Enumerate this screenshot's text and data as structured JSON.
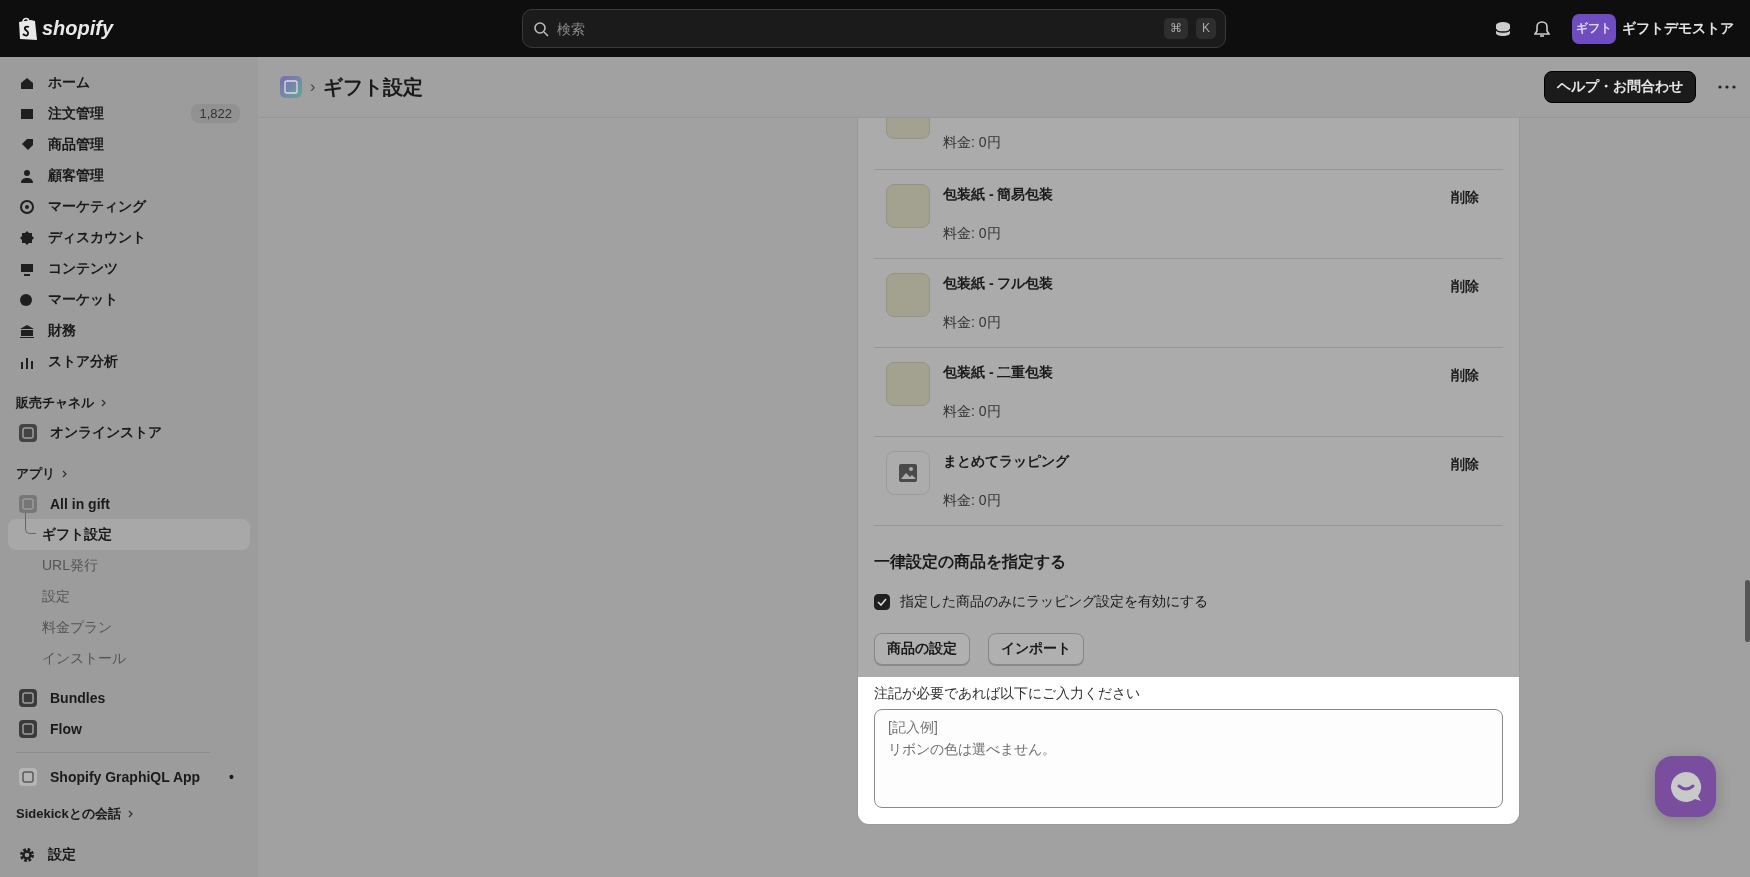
{
  "topbar": {
    "logo": "shopify",
    "search": {
      "placeholder": "検索",
      "keys": [
        "⌘",
        "K"
      ]
    },
    "store": {
      "avatar": "ギフト",
      "name": "ギフトデモストア"
    }
  },
  "sidebar": {
    "items": [
      {
        "label": "ホーム",
        "selected": false
      },
      {
        "label": "注文管理",
        "badge": "1,822",
        "selected": false
      },
      {
        "label": "商品管理",
        "selected": false
      },
      {
        "label": "顧客管理",
        "selected": false
      },
      {
        "label": "マーケティング",
        "selected": false
      },
      {
        "label": "ディスカウント",
        "selected": false
      },
      {
        "label": "コンテンツ",
        "selected": false
      },
      {
        "label": "マーケット",
        "selected": false
      },
      {
        "label": "財務",
        "selected": false
      },
      {
        "label": "ストア分析",
        "selected": false
      }
    ],
    "sales_channels": {
      "heading": "販売チャネル",
      "items": [
        {
          "label": "オンラインストア",
          "selected": false
        }
      ]
    },
    "apps": {
      "heading": "アプリ",
      "app": {
        "label": "All in gift",
        "children": [
          {
            "label": "ギフト設定",
            "selected": true
          },
          {
            "label": "URL発行",
            "selected": false
          },
          {
            "label": "設定",
            "selected": false
          },
          {
            "label": "料金プラン",
            "selected": false
          },
          {
            "label": "インストール",
            "selected": false
          }
        ]
      },
      "items": [
        {
          "label": "Bundles",
          "selected": false
        },
        {
          "label": "Flow",
          "selected": false
        }
      ]
    },
    "pinned": [
      {
        "label": "Shopify GraphiQL App",
        "dot": "•",
        "selected": false
      }
    ],
    "sidekick": {
      "heading": "Sidekickとの会話"
    },
    "settings": {
      "label": "設定",
      "selected": false
    }
  },
  "header": {
    "separator": "›",
    "title": "ギフト設定",
    "help_button": "ヘルプ・お問合わせ"
  },
  "card": {
    "wrappings": [
      {
        "kind": "paper",
        "price": "料金: 0円"
      },
      {
        "kind": "paper",
        "name": "包装紙 - 簡易包装",
        "price": "料金: 0円",
        "action": "削除"
      },
      {
        "kind": "paper",
        "name": "包装紙 - フル包装",
        "price": "料金: 0円",
        "action": "削除"
      },
      {
        "kind": "paper",
        "name": "包装紙 - 二重包装",
        "price": "料金: 0円",
        "action": "削除"
      },
      {
        "kind": "placeholder",
        "name": "まとめてラッピング",
        "price": "料金: 0円",
        "action": "削除"
      }
    ],
    "section_title": "一律設定の商品を指定する",
    "checkbox": {
      "label": "指定した商品のみにラッピング設定を有効にする",
      "checked": true
    },
    "buttons": [
      "商品の設定",
      "インポート"
    ],
    "notes": {
      "label": "注記が必要であれば以下にご入力ください",
      "placeholder": "[記入例]\nリボンの色は選べません。"
    }
  }
}
